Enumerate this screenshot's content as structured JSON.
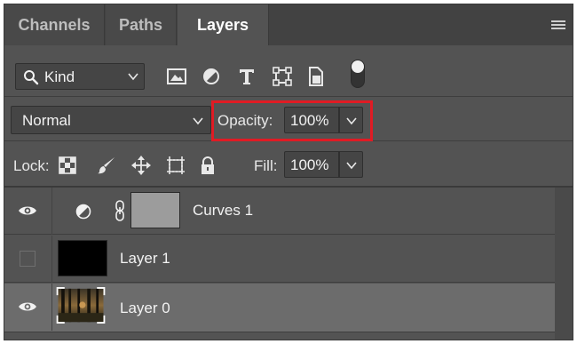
{
  "tabs": [
    {
      "label": "Channels",
      "active": false
    },
    {
      "label": "Paths",
      "active": false
    },
    {
      "label": "Layers",
      "active": true
    }
  ],
  "filter": {
    "kind_label": "Kind",
    "icons": [
      "image-filter-icon",
      "adjustment-filter-icon",
      "type-filter-icon",
      "shape-filter-icon",
      "smart-object-filter-icon"
    ],
    "filter_toggle_on": true
  },
  "blend": {
    "mode": "Normal",
    "opacity_label": "Opacity:",
    "opacity_value": "100%"
  },
  "lock": {
    "label": "Lock:",
    "icons": [
      "lock-transparent-pixels-icon",
      "lock-image-pixels-icon",
      "lock-position-icon",
      "lock-artboard-icon",
      "lock-all-icon"
    ],
    "fill_label": "Fill:",
    "fill_value": "100%"
  },
  "layers": [
    {
      "name": "Curves 1",
      "visible": true,
      "type": "adjustment",
      "selected": false
    },
    {
      "name": "Layer 1",
      "visible": false,
      "type": "pixel",
      "selected": false
    },
    {
      "name": "Layer 0",
      "visible": true,
      "type": "pixel",
      "selected": true
    }
  ],
  "colors": {
    "panel": "#535353",
    "highlight": "#e01b24",
    "selected_row": "#6c6c6c"
  }
}
